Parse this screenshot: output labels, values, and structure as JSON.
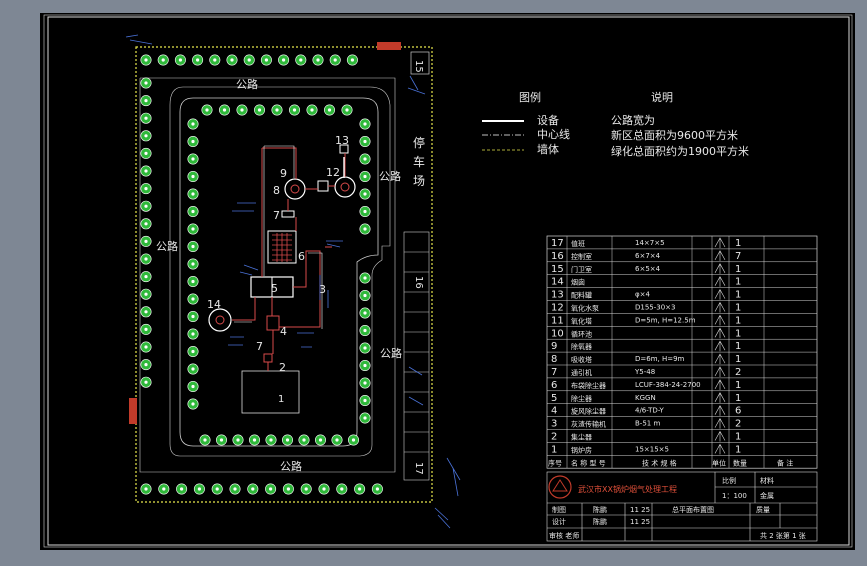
{
  "labels": {
    "road_top": "公路",
    "road_left": "公路",
    "road_right_top": "公路",
    "road_right_mid": "公路",
    "road_bottom": "公路",
    "parking_1": "停",
    "parking_2": "车",
    "parking_3": "场",
    "num_15": "15",
    "num_16": "16",
    "num_17": "17",
    "num_15_label": "15"
  },
  "equipment_numbers": [
    "1",
    "2",
    "3",
    "4",
    "5",
    "6",
    "7",
    "8",
    "9",
    "12",
    "13",
    "14",
    "7"
  ],
  "legend": {
    "title": "图例",
    "items": [
      {
        "label": "设备",
        "color": "#ffffff"
      },
      {
        "label": "中心线",
        "color": "#ffffff"
      },
      {
        "label": "墙体",
        "color": "#e6e64c"
      }
    ]
  },
  "notes": {
    "title": "说明",
    "lines": [
      "公路宽为",
      "新区总面积为9600平方米",
      "绿化总面积约为1900平方米"
    ]
  },
  "table": {
    "rows": [
      {
        "no": "17",
        "name": "值班",
        "spec": "14×7×5",
        "qty": "1"
      },
      {
        "no": "16",
        "name": "控制室",
        "spec": "6×7×4",
        "qty": "7"
      },
      {
        "no": "15",
        "name": "门卫室",
        "spec": "6×5×4",
        "qty": "1"
      },
      {
        "no": "14",
        "name": "烟囱",
        "spec": "",
        "qty": "1"
      },
      {
        "no": "13",
        "name": "配料罐",
        "spec": "φ×4",
        "qty": "1"
      },
      {
        "no": "12",
        "name": "氧化水泵",
        "spec": "D155-30×3",
        "qty": "1"
      },
      {
        "no": "11",
        "name": "氧化塔",
        "spec": "D=5m, H=12.5m",
        "qty": "1"
      },
      {
        "no": "10",
        "name": "循环池",
        "spec": "",
        "qty": "1"
      },
      {
        "no": "9",
        "name": "除氧器",
        "spec": "",
        "qty": "1"
      },
      {
        "no": "8",
        "name": "吸收塔",
        "spec": "D=6m, H=9m",
        "qty": "1"
      },
      {
        "no": "7",
        "name": "通引机",
        "spec": "Y5-48",
        "qty": "2"
      },
      {
        "no": "6",
        "name": "布袋除尘器",
        "spec": "LCUF-384-24-2700",
        "qty": "1"
      },
      {
        "no": "5",
        "name": "除尘器",
        "spec": "KGGN",
        "qty": "1"
      },
      {
        "no": "4",
        "name": "旋风除尘器",
        "spec": "4/6-TD-Y",
        "qty": "6"
      },
      {
        "no": "3",
        "name": "灰渣传输机",
        "spec": "B-51 m",
        "qty": "2"
      },
      {
        "no": "2",
        "name": "集尘器",
        "spec": "",
        "qty": "1"
      },
      {
        "no": "1",
        "name": "锅炉房",
        "spec": "15×15×5",
        "qty": "1"
      }
    ],
    "header": {
      "no": "序号",
      "name": "名 称 型 号",
      "spec": "技 术 规 格",
      "unit": "单位",
      "qty": "数量",
      "note": "备 注"
    },
    "title_block": {
      "project": "武汉市XX锅炉烟气处理工程",
      "scale_label": "比例",
      "scale": "1：100",
      "material_label": "材料",
      "material": "金属",
      "drawing_title": "总平面布置图",
      "row1_role": "制图",
      "row2_role": "设计",
      "row3_role": "审核 老师",
      "name": "陈鹏",
      "date": "11 25",
      "weight_label": "质量",
      "sheet": "共 2 张第 1 张"
    }
  }
}
